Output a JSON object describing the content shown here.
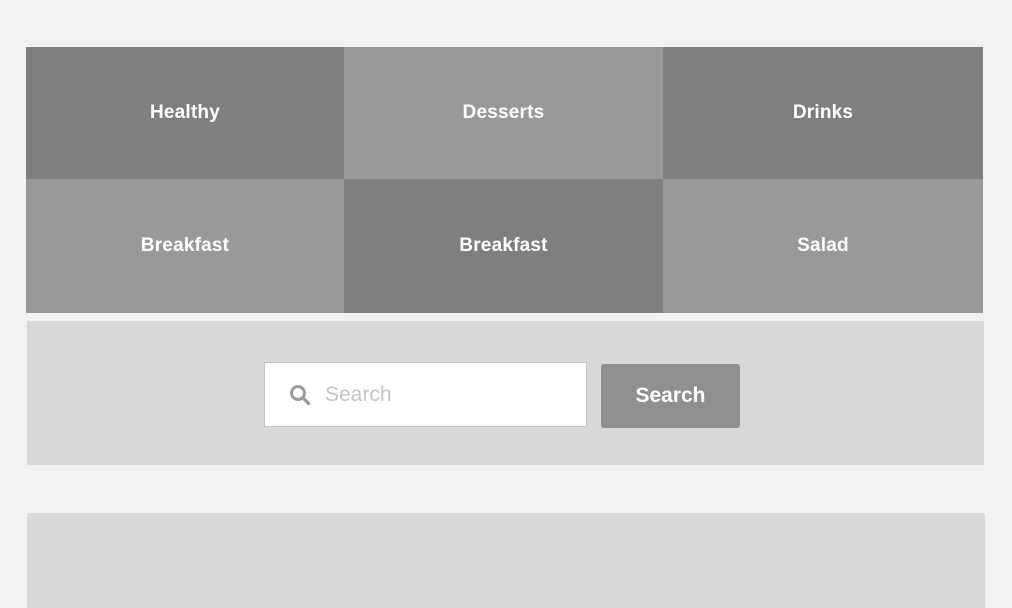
{
  "categories": [
    {
      "label": "Healthy",
      "color": "#7f7f7f"
    },
    {
      "label": "Desserts",
      "color": "#999999"
    },
    {
      "label": "Drinks",
      "color": "#7f7f7f"
    },
    {
      "label": "Breakfast",
      "color": "#999999"
    },
    {
      "label": "Breakfast",
      "color": "#7f7f7f"
    },
    {
      "label": "Salad",
      "color": "#999999"
    }
  ],
  "search": {
    "placeholder": "Search",
    "value": "",
    "button_label": "Search",
    "icon": "search-icon"
  },
  "colors": {
    "page_background": "#f2f2f2",
    "panel": "#d8d8d8",
    "tile_dark": "#7f7f7f",
    "tile_light": "#999999",
    "button": "#8f8f8f"
  }
}
